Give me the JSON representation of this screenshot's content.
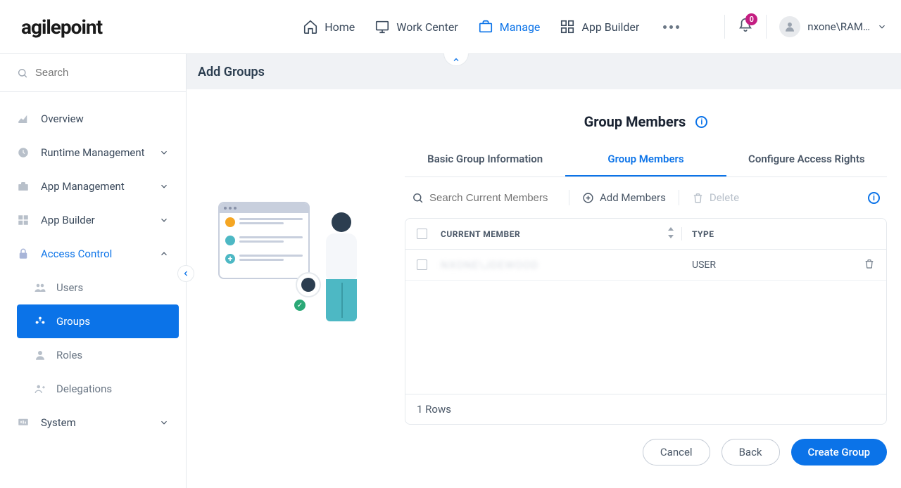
{
  "logo": "agilepoint",
  "nav": {
    "home": "Home",
    "workCenter": "Work Center",
    "manage": "Manage",
    "appBuilder": "App Builder"
  },
  "notifications": {
    "count": "0"
  },
  "user": {
    "name": "nxone\\RAM…"
  },
  "sidebar": {
    "searchPlaceholder": "Search",
    "overview": "Overview",
    "runtime": "Runtime Management",
    "appMgmt": "App Management",
    "appBuilder": "App Builder",
    "accessControl": "Access Control",
    "users": "Users",
    "groups": "Groups",
    "roles": "Roles",
    "delegations": "Delegations",
    "system": "System"
  },
  "content": {
    "header": "Add Groups",
    "panelTitle": "Group Members",
    "tabs": {
      "basic": "Basic Group Information",
      "members": "Group Members",
      "rights": "Configure Access Rights"
    },
    "actions": {
      "searchPlaceholder": "Search Current Members",
      "addMembers": "Add Members",
      "delete": "Delete"
    },
    "table": {
      "colMember": "CURRENT MEMBER",
      "colType": "TYPE",
      "rows": [
        {
          "member": "NXONE\\JDEWOOD",
          "type": "USER"
        }
      ],
      "footer": "1 Rows"
    },
    "buttons": {
      "cancel": "Cancel",
      "back": "Back",
      "create": "Create Group"
    }
  }
}
